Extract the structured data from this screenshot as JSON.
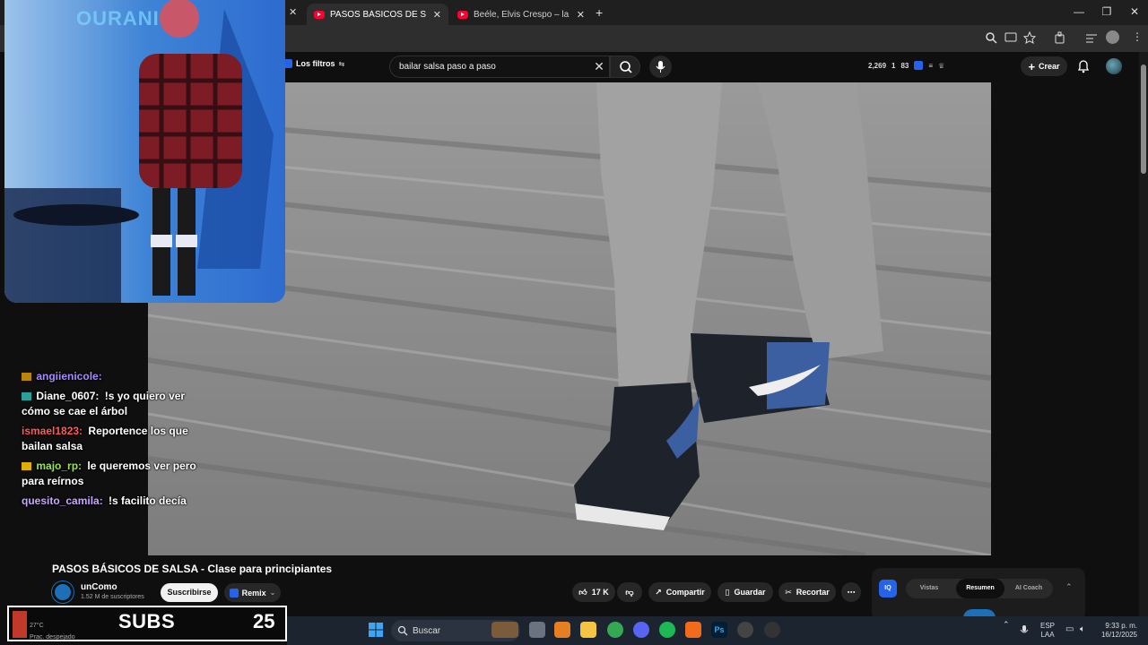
{
  "browser": {
    "tabs": [
      {
        "label": "PASOS BÁSICOS DE SALSA - Cl",
        "active": true
      },
      {
        "label": "Beéle, Elvis Crespo – la patadita",
        "active": false
      }
    ],
    "new_tab": "+",
    "close_glyph": "✕",
    "window": {
      "minimize": "—",
      "restore": "❐",
      "close": "✕"
    }
  },
  "youtube": {
    "filters_label": "Los filtros",
    "search": {
      "value": "bailar salsa paso a paso",
      "clear": "✕"
    },
    "stats": {
      "views": "2,269",
      "one": "1",
      "eyes": "83"
    },
    "create_label": "Crear",
    "video": {
      "title": "PASOS BÁSICOS DE SALSA - Clase para principiantes",
      "channel": "unComo",
      "subscribers": "1.52 M de suscriptores",
      "subscribe_label": "Suscribirse",
      "remix_label": "Remix",
      "likes": "17 K",
      "share_label": "Compartir",
      "save_label": "Guardar",
      "clip_label": "Recortar"
    },
    "iq_panel": {
      "logo": "IQ",
      "tabs": [
        "Vistas",
        "Resumen",
        "AI Coach"
      ],
      "selected_tab": "Resumen"
    }
  },
  "stream_overlay": {
    "webcam_logo": "OURANI",
    "chat": [
      {
        "user": "angiienicole:",
        "user_color": "#a78bfa",
        "text": ""
      },
      {
        "user": "Diane_0607:",
        "user_color": "#ffffff",
        "text": "!s yo quiero ver cómo se cae el árbol"
      },
      {
        "user": "ismael1823:",
        "user_color": "#ff5a5a",
        "text": "Reportence los que bailan salsa"
      },
      {
        "user": "majo_rp:",
        "user_color": "#9be35a",
        "text": "le queremos ver pero para reírnos"
      },
      {
        "user": "quesito_camila:",
        "user_color": "#c7a6ff",
        "text": "!s facilito decía"
      }
    ],
    "subs_label": "SUBS",
    "subs_count": "25",
    "weather": {
      "temp": "27°C",
      "desc": "Prac. despejado"
    }
  },
  "taskbar": {
    "search_placeholder": "Buscar",
    "lang": {
      "line1": "ESP",
      "line2": "LAA"
    },
    "time": "9:33 p. m.",
    "date": "16/12/2025"
  }
}
